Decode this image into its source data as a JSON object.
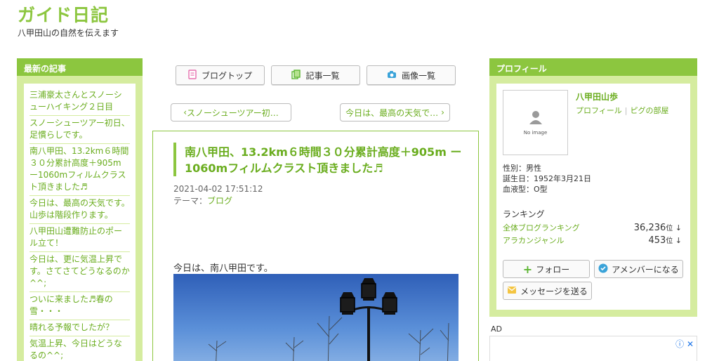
{
  "site": {
    "title": "ガイド日記",
    "description": "八甲田山の自然を伝えます"
  },
  "left_sidebar": {
    "heading": "最新の記事",
    "items": [
      "三浦豪太さんとスノーシューハイキング２日目",
      "スノーシューツアー初日、足慣らしです。",
      "南八甲田、13.2km６時間３０分累計高度＋905m ー1060mフィルムクラスト頂きました♬",
      "今日は、最高の天気です。山歩は階段作ります。",
      "八甲田山遭難防止のポール立て！",
      "今日は、更に気温上昇です。さてさてどうなるのか^^;",
      "ついに来ました♬春の雪・・・",
      "晴れる予報でしたが？",
      "気温上昇、今日はどうなるの^^;"
    ]
  },
  "nav": {
    "blog_top": "ブログトップ",
    "article_list": "記事一覧",
    "image_list": "画像一覧"
  },
  "pager": {
    "prev": "スノーシューツアー初…",
    "next": "今日は、最高の天気で…"
  },
  "article": {
    "title": "南八甲田、13.2km６時間３０分累計高度＋905m ー1060mフィルムクラスト頂きました♬",
    "datetime": "2021-04-02 17:51:12",
    "theme_label": "テーマ：",
    "theme_value": "ブログ",
    "body_text": "今日は、南八甲田です。"
  },
  "profile": {
    "heading": "プロフィール",
    "no_image": "No image",
    "name": "八甲田山歩",
    "link_profile": "プロフィール",
    "link_room": "ピグの部屋",
    "gender": "性別：男性",
    "birthday": "誕生日：1952年3月21日",
    "blood": "血液型：O型",
    "ranking_heading": "ランキング",
    "rankings": [
      {
        "name": "全体ブログランキング",
        "value": "36,236",
        "unit": "位",
        "arrow": "↓"
      },
      {
        "name": "アラカンジャンル",
        "value": "453",
        "unit": "位",
        "arrow": "↓"
      }
    ],
    "follow": "フォロー",
    "amember": "アメンバーになる",
    "message": "メッセージを送る"
  },
  "ad": {
    "label": "AD"
  },
  "colors": {
    "accent": "#8cc63f",
    "accent_light": "#d5ec9f",
    "link": "#6aad1e"
  }
}
